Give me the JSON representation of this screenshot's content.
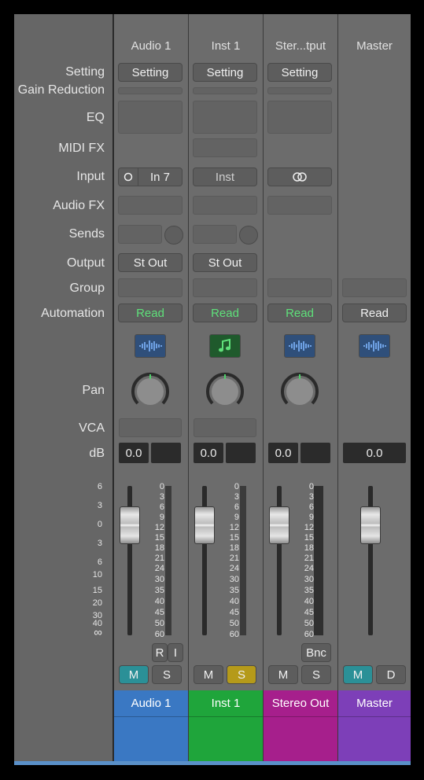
{
  "row_labels": [
    "Setting",
    "Gain Reduction",
    "EQ",
    "MIDI FX",
    "Input",
    "Audio FX",
    "Sends",
    "Output",
    "Group",
    "Automation",
    "Pan",
    "VCA",
    "dB"
  ],
  "left_scale": [
    "6",
    "3",
    "0",
    "3",
    "6",
    "10",
    "15",
    "20",
    "30",
    "40",
    "∞"
  ],
  "meter_scale": [
    "0",
    "3",
    "6",
    "9",
    "12",
    "15",
    "18",
    "21",
    "24",
    "30",
    "35",
    "40",
    "45",
    "50",
    "60"
  ],
  "strips": [
    {
      "name": "Audio 1",
      "setting": "Setting",
      "input_label": "In 7",
      "output": "St Out",
      "automation": "Read",
      "db": "0.0",
      "rec_label": "R",
      "input_mon_label": "I",
      "mute": "M",
      "solo": "S",
      "track_name": "Audio 1",
      "color": "#3a78c3",
      "icon": "waveform-icon"
    },
    {
      "name": "Inst 1",
      "setting": "Setting",
      "input_label": "Inst",
      "output": "St Out",
      "automation": "Read",
      "db": "0.0",
      "mute": "M",
      "solo": "S",
      "track_name": "Inst 1",
      "color": "#1fa53b",
      "icon": "music-note-icon"
    },
    {
      "name": "Ster...tput",
      "setting": "Setting",
      "automation": "Read",
      "db": "0.0",
      "bounce_label": "Bnc",
      "mute": "M",
      "solo": "S",
      "track_name": "Stereo Out",
      "color": "#a61f8c",
      "icon": "waveform-icon"
    },
    {
      "name": "Master",
      "automation": "Read",
      "db": "0.0",
      "mute": "M",
      "dim": "D",
      "track_name": "Master",
      "color": "#7d3fb8",
      "icon": "waveform-icon"
    }
  ]
}
